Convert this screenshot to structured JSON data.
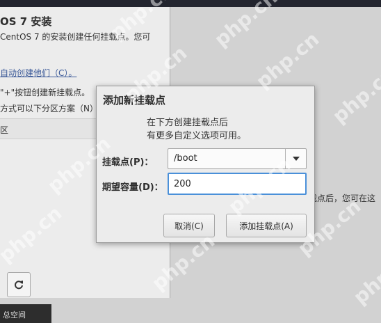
{
  "background": {
    "title": "OS 7 安装",
    "lines": [
      "CentOS 7 的安装创建任何挂载点。您可",
      "\"+\"按钮创建新挂载点。",
      "方式可以下分区方案（N）"
    ],
    "auto_link": "自动创建他们（C）。",
    "row_label": "区",
    "right_text": "载点后，您可在这",
    "space_label": "总空间",
    "refresh_icon": "refresh-icon"
  },
  "dialog": {
    "title": "添加新挂载点",
    "description": [
      "在下方创建挂载点后",
      "有更多自定义选项可用。"
    ],
    "mount_point_label": "挂载点(P)：",
    "mount_point_value": "/boot",
    "capacity_label": "期望容量(D)：",
    "capacity_value": "200",
    "cancel_label": "取消(C)",
    "add_label": "添加挂载点(A)",
    "dropdown_icon": "chevron-down-icon"
  },
  "watermark": "php.cn",
  "colors": {
    "focus": "#4a90d9",
    "topbar": "#23252f"
  }
}
